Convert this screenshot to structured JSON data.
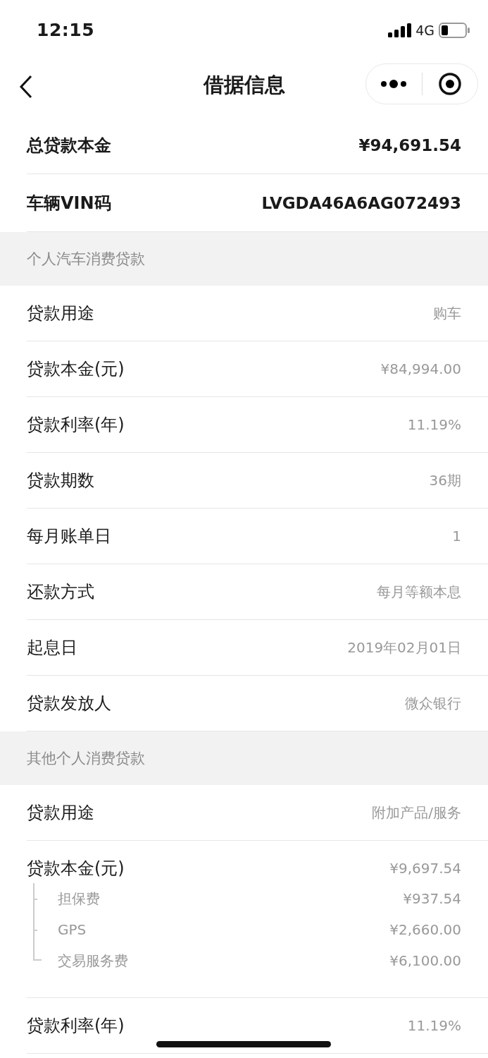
{
  "status_bar": {
    "time": "12:15",
    "network": "4G"
  },
  "nav": {
    "title": "借据信息"
  },
  "summary": [
    {
      "label": "总贷款本金",
      "value": "¥94,691.54"
    },
    {
      "label": "车辆VIN码",
      "value": "LVGDA46A6AG072493"
    }
  ],
  "sections": [
    {
      "title": "个人汽车消费贷款",
      "rows": [
        {
          "label": "贷款用途",
          "value": "购车"
        },
        {
          "label": "贷款本金(元)",
          "value": "¥84,994.00"
        },
        {
          "label": "贷款利率(年)",
          "value": "11.19%"
        },
        {
          "label": "贷款期数",
          "value": "36期"
        },
        {
          "label": "每月账单日",
          "value": "1"
        },
        {
          "label": "还款方式",
          "value": "每月等额本息"
        },
        {
          "label": "起息日",
          "value": "2019年02月01日"
        },
        {
          "label": "贷款发放人",
          "value": "微众银行"
        }
      ]
    },
    {
      "title": "其他个人消费贷款",
      "rows": [
        {
          "label": "贷款用途",
          "value": "附加产品/服务"
        },
        {
          "label": "贷款本金(元)",
          "value": "¥9,697.54",
          "children": [
            {
              "label": "担保费",
              "value": "¥937.54"
            },
            {
              "label": "GPS",
              "value": "¥2,660.00"
            },
            {
              "label": "交易服务费",
              "value": "¥6,100.00"
            }
          ]
        },
        {
          "label": "贷款利率(年)",
          "value": "11.19%"
        }
      ]
    }
  ]
}
